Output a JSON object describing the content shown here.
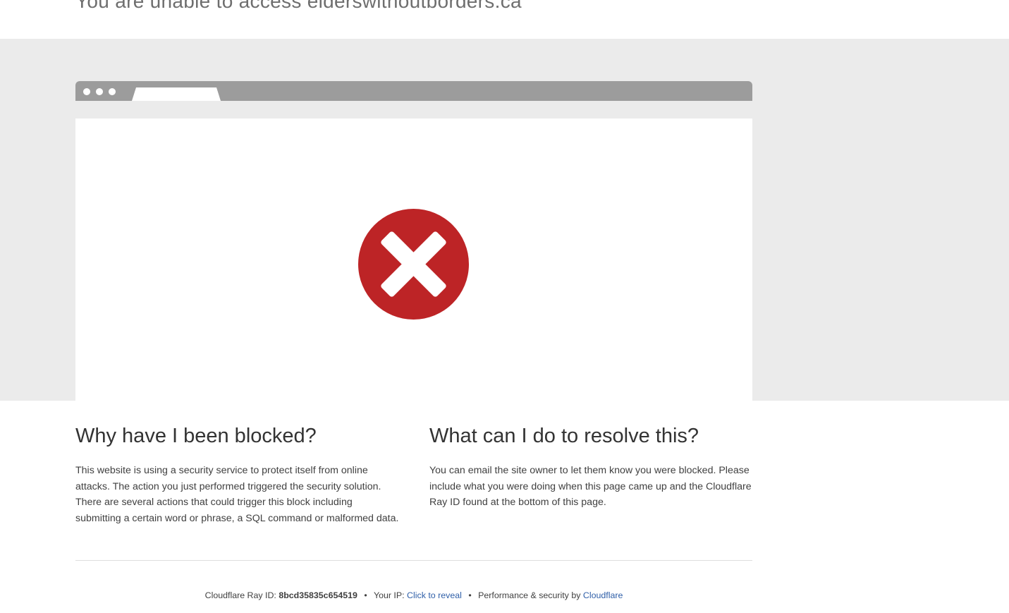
{
  "header": {
    "title": "You are unable to access elderswithoutborders.ca"
  },
  "main": {
    "icon": "error-x-circle-icon",
    "error_color": "#bd2426"
  },
  "left_column": {
    "heading": "Why have I been blocked?",
    "body": "This website is using a security service to protect itself from online attacks. The action you just performed triggered the security solution. There are several actions that could trigger this block including submitting a certain word or phrase, a SQL command or malformed data."
  },
  "right_column": {
    "heading": "What can I do to resolve this?",
    "body": "You can email the site owner to let them know you were blocked. Please include what you were doing when this page came up and the Cloudflare Ray ID found at the bottom of this page."
  },
  "footer": {
    "ray_label": "Cloudflare Ray ID:",
    "ray_id": "8bcd35835c654519",
    "separator": "•",
    "ip_label": "Your IP:",
    "ip_link": "Click to reveal",
    "perf_label": "Performance & security by",
    "perf_link": "Cloudflare"
  }
}
